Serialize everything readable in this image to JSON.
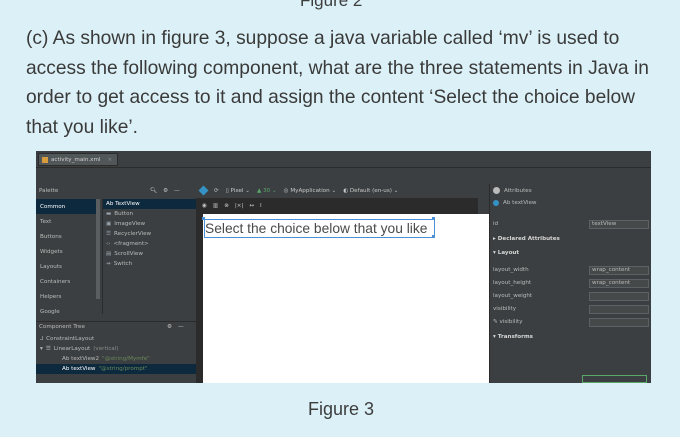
{
  "page": {
    "top_fragment": "Figure 2",
    "question": "(c)  As shown in figure 3, suppose a java variable called ‘mv’ is used to access the following component, what are the three statements in Java in order to get access to it and assign the content ‘Select the choice below that you like’.",
    "caption": "Figure 3"
  },
  "ide": {
    "file_tab": "activity_main.xml",
    "palette": {
      "title": "Palette",
      "categories": [
        "Common",
        "Text",
        "Buttons",
        "Widgets",
        "Layouts",
        "Containers",
        "Helpers",
        "Google"
      ],
      "selected_category": "Common",
      "widgets": [
        "Ab TextView",
        "Button",
        "ImageView",
        "RecyclerView",
        "<fragment>",
        "ScrollView",
        "Switch"
      ]
    },
    "toolbar": {
      "pixel": "Pixel",
      "api": "30",
      "app": "MyApplication",
      "locale": "Default (en-us)"
    },
    "component_tree": {
      "title": "Component Tree",
      "nodes": [
        {
          "label": "ConstraintLayout",
          "extra": ""
        },
        {
          "label": "LinearLayout",
          "extra": "(vertical)"
        },
        {
          "label": "Ab textView2",
          "extra": "\"@string/Mymfe\""
        },
        {
          "label": "Ab textView",
          "extra": "\"@string/prompt\""
        }
      ]
    },
    "design": {
      "textview_text": "Select the choice below that you like"
    },
    "attributes": {
      "title": "Attributes",
      "component": "Ab textView",
      "id_label": "id",
      "id_value": "textView",
      "declared": "Declared Attributes",
      "layout": "Layout",
      "rows": [
        {
          "label": "layout_width",
          "value": "wrap_content"
        },
        {
          "label": "layout_height",
          "value": "wrap_content"
        },
        {
          "label": "layout_weight",
          "value": ""
        },
        {
          "label": "visibility",
          "value": ""
        },
        {
          "label": "visibility",
          "value": ""
        }
      ],
      "transforms": "Transforms"
    }
  }
}
